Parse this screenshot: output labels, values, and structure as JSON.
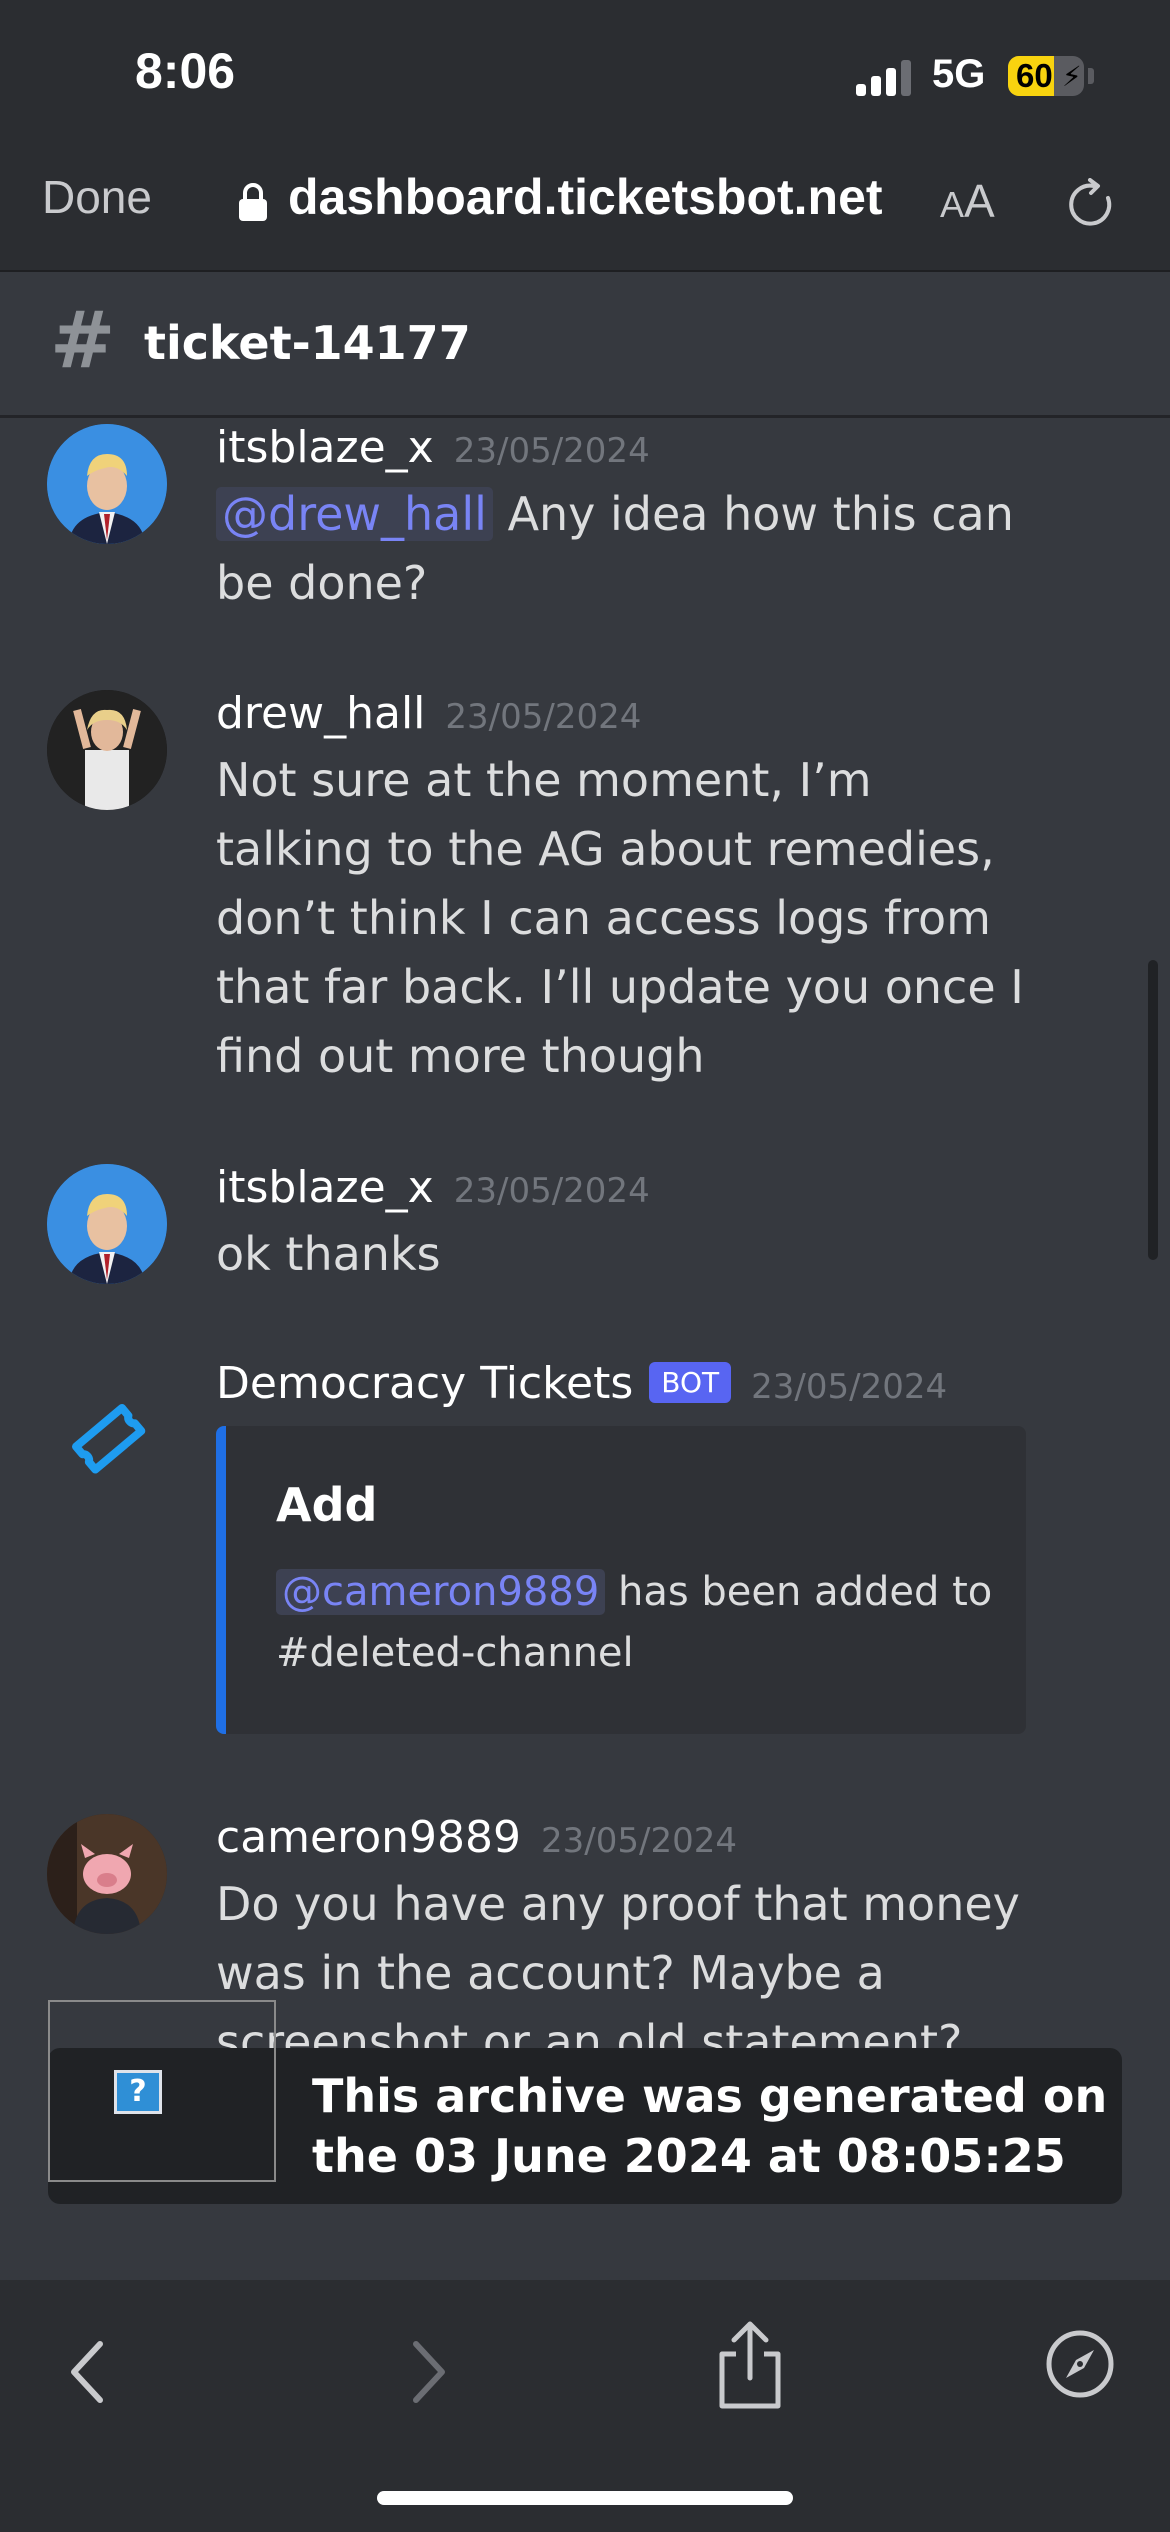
{
  "status_bar": {
    "time": "8:06",
    "network": "5G",
    "battery_percent": "60",
    "battery_level": 0.6,
    "signal_bars_active": 3,
    "signal_bars_total": 4
  },
  "browser": {
    "done_label": "Done",
    "url": "dashboard.ticketsbot.net",
    "text_size_label": "AA",
    "lock_icon": "lock-icon",
    "reload_icon": "reload-icon"
  },
  "channel": {
    "hash_symbol": "#",
    "name": "ticket-14177"
  },
  "messages": [
    {
      "author": "itsblaze_x",
      "timestamp": "23/05/2024",
      "mention": "@drew_hall",
      "text": "Any idea how this can be done?"
    },
    {
      "author": "drew_hall",
      "timestamp": "23/05/2024",
      "text": "Not sure at the moment, I’m talking to the AG about remedies, don’t think I can access logs from that far back. I’ll update you once I find out more though"
    },
    {
      "author": "itsblaze_x",
      "timestamp": "23/05/2024",
      "text": "ok thanks"
    },
    {
      "author": "Democracy Tickets",
      "bot_tag": "BOT",
      "timestamp": "23/05/2024",
      "embed": {
        "title": "Add",
        "mention": "@cameron9889",
        "text": "has been added to #deleted-channel"
      }
    },
    {
      "author": "cameron9889",
      "timestamp": "23/05/2024",
      "text": "Do you have any proof that money was in the account? Maybe a screenshot or an old statement?"
    }
  ],
  "archive": {
    "text": "This archive was generated on the 03 June 2024 at 08:05:25",
    "image_placeholder": "?"
  },
  "toolbar": {
    "icons": [
      "back-icon",
      "forward-icon",
      "share-icon",
      "compass-icon"
    ]
  },
  "colors": {
    "background": "#36393f",
    "mention_text": "#7984f5",
    "bot_tag": "#5865f2",
    "embed_border": "#1f6fe5",
    "battery": "#f8d30f"
  }
}
